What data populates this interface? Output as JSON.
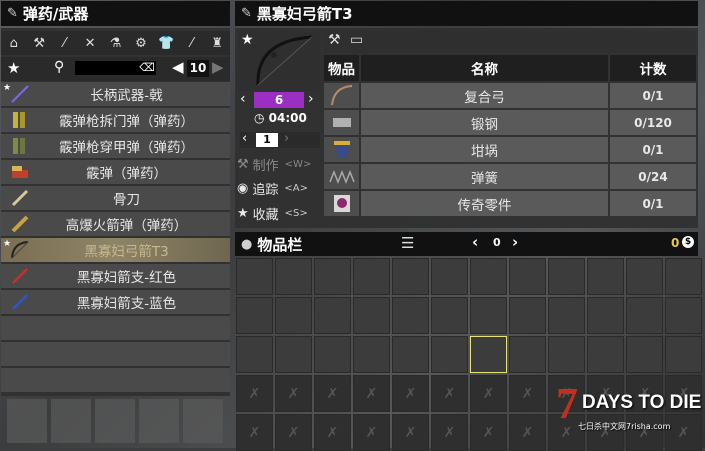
{
  "left_panel": {
    "title": "弹药/武器",
    "categories": [
      "home-icon",
      "tools-icon",
      "ammo-icon",
      "wrench-icon",
      "chemistry-icon",
      "gear-icon",
      "clothing-icon",
      "knife-icon",
      "seat-icon"
    ],
    "search_placeholder": "",
    "page_number": "10",
    "items": [
      {
        "label": "长柄武器-戟",
        "starred": true,
        "selected": false
      },
      {
        "label": "霰弹枪拆门弹（弹药）",
        "starred": false,
        "selected": false
      },
      {
        "label": "霰弹枪穿甲弹（弹药）",
        "starred": false,
        "selected": false
      },
      {
        "label": "霰弹（弹药）",
        "starred": false,
        "selected": false
      },
      {
        "label": "骨刀",
        "starred": false,
        "selected": false
      },
      {
        "label": "高爆火箭弹（弹药）",
        "starred": false,
        "selected": false
      },
      {
        "label": "黑寡妇弓箭T3",
        "starred": true,
        "selected": true
      },
      {
        "label": "黑寡妇箭支-红色",
        "starred": false,
        "selected": false
      },
      {
        "label": "黑寡妇箭支-蓝色",
        "starred": false,
        "selected": false
      }
    ]
  },
  "recipe": {
    "title": "黑寡妇弓箭T3",
    "quantity": "6",
    "time": "04:00",
    "count_input": "1",
    "craft_label": "制作",
    "craft_key": "<W>",
    "track_label": "追踪",
    "track_key": "<A>",
    "favorite_label": "收藏",
    "favorite_key": "<S>",
    "table_headers": {
      "item": "物品",
      "name": "名称",
      "count": "计数"
    },
    "ingredients": [
      {
        "name": "复合弓",
        "count": "0/1"
      },
      {
        "name": "锻钢",
        "count": "0/120"
      },
      {
        "name": "坩埚",
        "count": "0/1"
      },
      {
        "name": "弹簧",
        "count": "0/24"
      },
      {
        "name": "传奇零件",
        "count": "0/1"
      }
    ]
  },
  "inventory": {
    "title": "物品栏",
    "page": "0",
    "currency": "0"
  },
  "watermark": {
    "logo_text": "7 DAYS TO DIE",
    "site": "七日杀中文网7risha.com"
  },
  "colors": {
    "quantity_bar": "#9b2fc4",
    "selected_row": "#8e8466",
    "highlight_slot": "#e8e27a"
  }
}
